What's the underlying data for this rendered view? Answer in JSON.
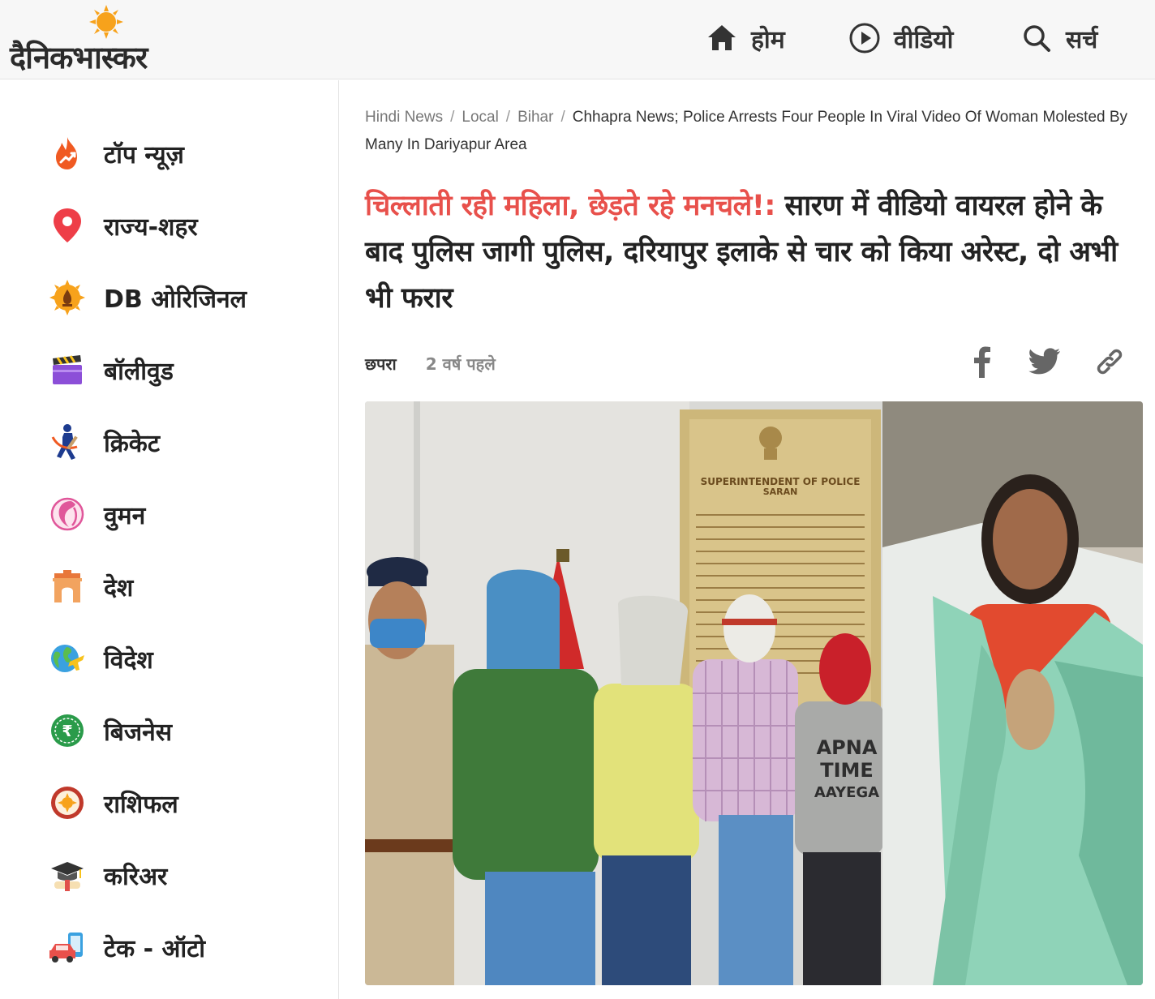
{
  "header": {
    "logo_text": "दैनिकभास्कर",
    "nav": [
      {
        "label": "होम",
        "icon": "home-icon"
      },
      {
        "label": "वीडियो",
        "icon": "play-circle-icon"
      },
      {
        "label": "सर्च",
        "icon": "search-icon"
      }
    ]
  },
  "sidebar": {
    "items": [
      {
        "label": "टॉप न्यूज़",
        "icon": "flame-trending-icon"
      },
      {
        "label": "राज्य-शहर",
        "icon": "location-pin-icon"
      },
      {
        "label": "DB ओरिजिनल",
        "icon": "db-original-icon"
      },
      {
        "label": "बॉलीवुड",
        "icon": "clapperboard-icon"
      },
      {
        "label": "क्रिकेट",
        "icon": "cricket-batsman-icon"
      },
      {
        "label": "वुमन",
        "icon": "woman-face-icon"
      },
      {
        "label": "देश",
        "icon": "india-gate-icon"
      },
      {
        "label": "विदेश",
        "icon": "globe-plane-icon"
      },
      {
        "label": "बिजनेस",
        "icon": "rupee-coin-icon"
      },
      {
        "label": "राशिफल",
        "icon": "zodiac-wheel-icon"
      },
      {
        "label": "करिअर",
        "icon": "graduation-cap-icon"
      },
      {
        "label": "टेक - ऑटो",
        "icon": "car-phone-icon"
      }
    ]
  },
  "breadcrumb": {
    "items": [
      "Hindi News",
      "Local",
      "Bihar"
    ],
    "current": "Chhapra News; Police Arrests Four People In Viral Video Of Woman Molested By Many In Dariyapur Area",
    "separator": "/"
  },
  "article": {
    "headline_highlight": "चिल्लाती रही महिला, छेड़ते रहे मनचले!:",
    "headline_rest": " सारण में वीडियो वायरल होने के बाद पुलिस जागी पुलिस, दरियापुर इलाके से चार को किया अरेस्ट, दो अभी भी फरार",
    "city": "छपरा",
    "time": "2 वर्ष पहले",
    "share": [
      "facebook-icon",
      "twitter-icon",
      "link-icon"
    ]
  },
  "hero_image": {
    "board_title": "SUPERINTENDENT OF POLICE",
    "board_subtitle": "SARAN",
    "shirt_text_1": "APNA",
    "shirt_text_2": "TIME",
    "shirt_text_3": "AAYEGA"
  },
  "colors": {
    "headline_accent": "#e8504b",
    "header_bg": "#f7f7f7",
    "logo_sun": "#f7a21b"
  }
}
